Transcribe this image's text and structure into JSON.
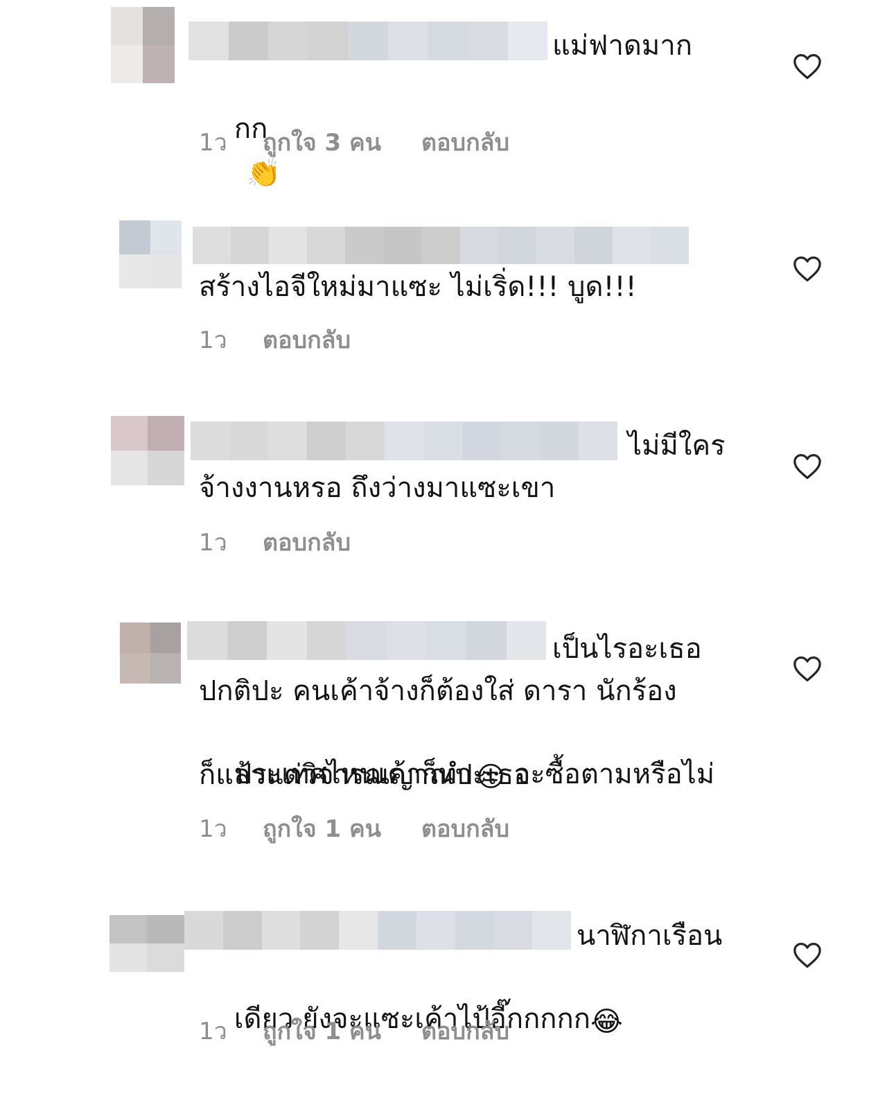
{
  "accent": {
    "meta": "#8e8e8e",
    "text": "#141414",
    "heart": "#262626"
  },
  "comments": [
    {
      "username_hidden": true,
      "text_first": "แม่ฟาดมาก",
      "text_rest": "กก",
      "emoji": "👏",
      "time": "1ว",
      "likes": "ถูกใจ 3 คน",
      "reply": "ตอบกลับ",
      "icon": "heart-outline-icon"
    },
    {
      "username_hidden": true,
      "text_first": "",
      "text_rest": "สร้างไอจีใหม่มาแซะ ไม่เริ่ด!!! บูด!!!",
      "time": "1ว",
      "likes": "",
      "reply": "ตอบกลับ",
      "icon": "heart-outline-icon"
    },
    {
      "username_hidden": true,
      "text_first": "ไม่มีใคร",
      "text_rest": "จ้างงานหรอ ถึงว่างมาแซะเขา",
      "time": "1ว",
      "likes": "",
      "reply": "ตอบกลับ",
      "icon": "heart-outline-icon"
    },
    {
      "username_hidden": true,
      "text_first": "เป็นไรอะเธอ",
      "line2": "ปกติปะ คนเค้าจ้างก็ต้องใส่ ดารา นักร้อง",
      "line3_a": "ประเทศไหนเค้าก็ทำ",
      "emoji": "😒",
      "line3_b": " จะซื้อตามหรือไม่",
      "line4": "ก็แล้วแต่วิจารณญาณปะเธอ",
      "time": "1ว",
      "likes": "ถูกใจ 1 คน",
      "reply": "ตอบกลับ",
      "icon": "heart-outline-icon"
    },
    {
      "username_hidden": true,
      "text_first": "นาฬิกาเรือน",
      "text_rest": "เดียว ยังจะแซะเค้าไป้อี๊กกกกก",
      "emoji": "😂",
      "time": "1ว",
      "likes": "ถูกใจ 1 คน",
      "reply": "ตอบกลับ",
      "icon": "heart-outline-icon"
    }
  ]
}
